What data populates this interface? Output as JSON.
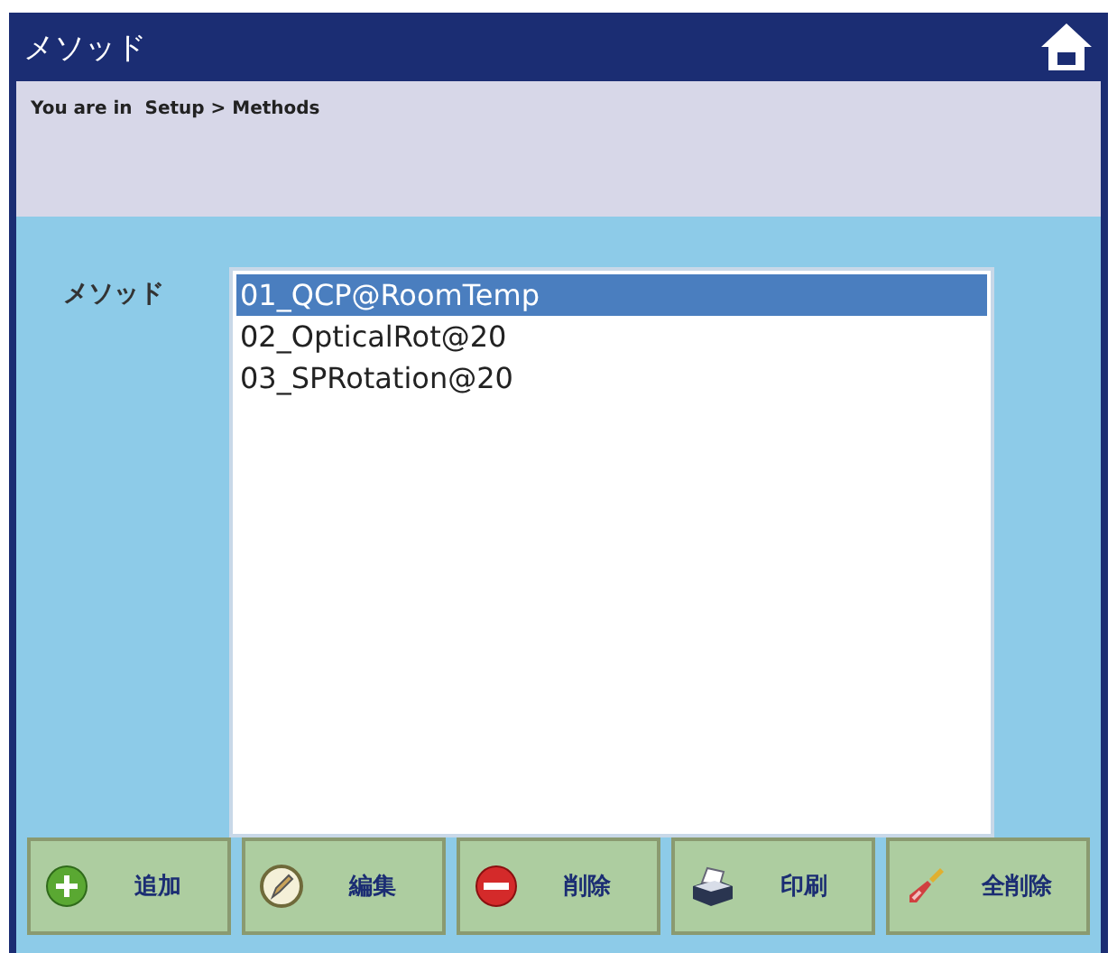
{
  "window": {
    "title": "メソッド"
  },
  "breadcrumb": "You are in  Setup > Methods",
  "method_label": "メソッド",
  "methods": [
    {
      "label": "01_QCP@RoomTemp",
      "selected": true
    },
    {
      "label": "02_OpticalRot@20",
      "selected": false
    },
    {
      "label": "03_SPRotation@20",
      "selected": false
    }
  ],
  "buttons": [
    {
      "label": "追加",
      "kind": "add"
    },
    {
      "label": "編集",
      "kind": "edit"
    },
    {
      "label": "削除",
      "kind": "delete"
    },
    {
      "label": "印刷",
      "kind": "print"
    },
    {
      "label": "全削除",
      "kind": "clear"
    }
  ]
}
